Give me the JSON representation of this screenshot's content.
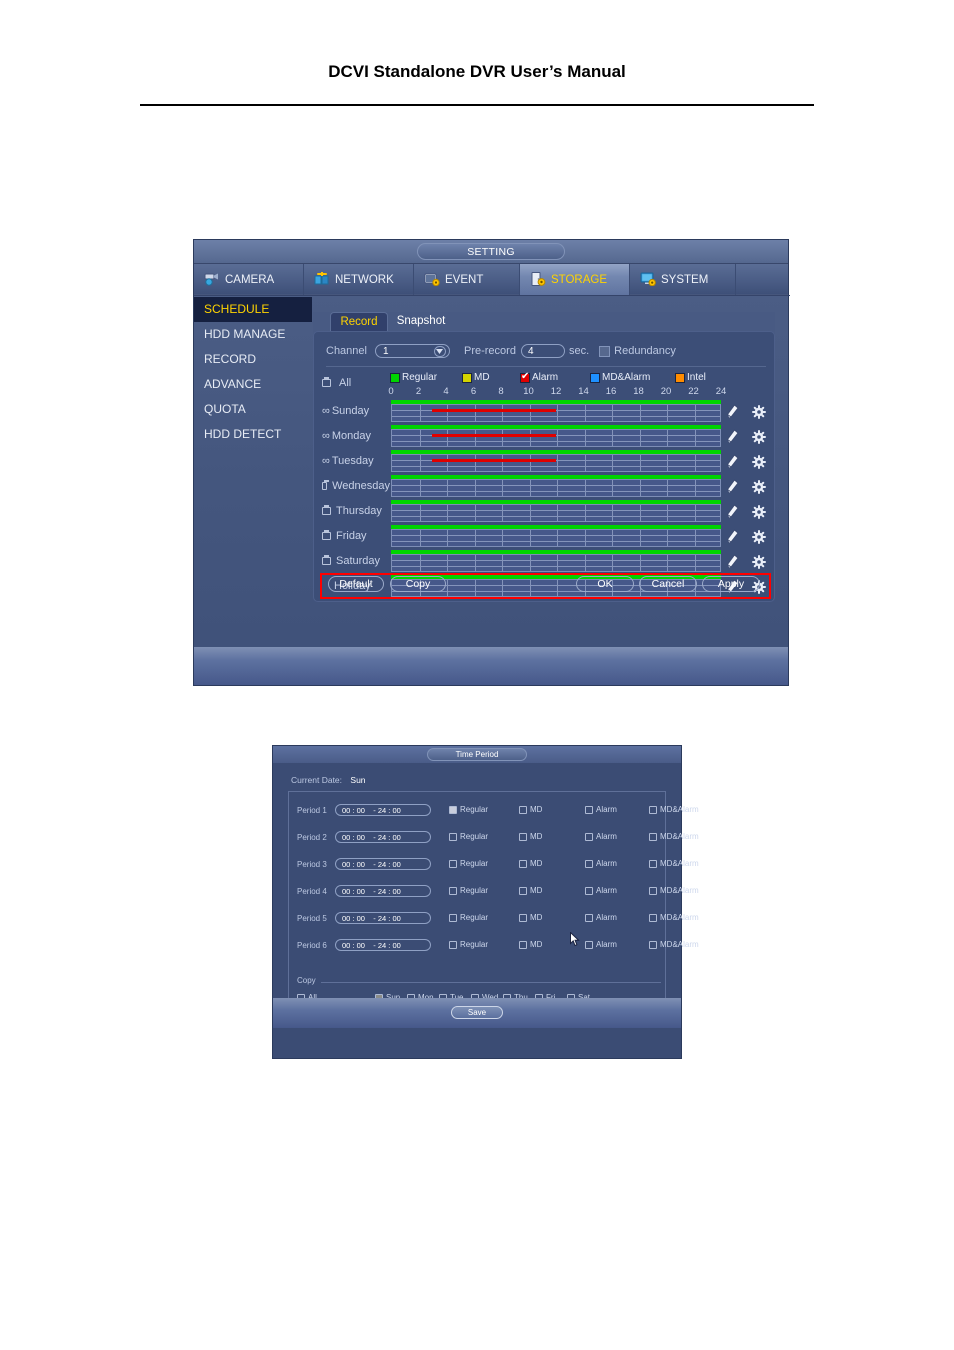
{
  "page": {
    "header_title": "DCVI Standalone DVR User’s Manual"
  },
  "setting_window": {
    "title": "SETTING",
    "top_tabs": [
      {
        "label": "CAMERA",
        "icon": "camera-icon",
        "active": false
      },
      {
        "label": "NETWORK",
        "icon": "network-icon",
        "active": false
      },
      {
        "label": "EVENT",
        "icon": "event-icon",
        "active": false
      },
      {
        "label": "STORAGE",
        "icon": "storage-icon",
        "active": true
      },
      {
        "label": "SYSTEM",
        "icon": "system-icon",
        "active": false
      }
    ],
    "side_menu": [
      {
        "label": "SCHEDULE",
        "active": true
      },
      {
        "label": "HDD MANAGE",
        "active": false
      },
      {
        "label": "RECORD",
        "active": false
      },
      {
        "label": "ADVANCE",
        "active": false
      },
      {
        "label": "QUOTA",
        "active": false
      },
      {
        "label": "HDD DETECT",
        "active": false
      }
    ],
    "inner_tabs": [
      {
        "label": "Record",
        "active": true
      },
      {
        "label": "Snapshot",
        "active": false
      }
    ],
    "channel_label": "Channel",
    "channel_value": "1",
    "prerecord_label": "Pre-record",
    "prerecord_value": "4",
    "sec_label": "sec.",
    "redundancy_label": "Redundancy",
    "legend": [
      {
        "label": "Regular",
        "color": "#00d400",
        "checked": false
      },
      {
        "label": "MD",
        "color": "#d4d400",
        "checked": false
      },
      {
        "label": "Alarm",
        "color": "#e00000",
        "checked": true
      },
      {
        "label": "MD&Alarm",
        "color": "#1e90ff",
        "checked": false
      },
      {
        "label": "Intel",
        "color": "#ff8c00",
        "checked": false
      }
    ],
    "ruler_ticks": [
      "0",
      "2",
      "4",
      "6",
      "8",
      "10",
      "12",
      "14",
      "16",
      "18",
      "20",
      "22",
      "24"
    ],
    "all_label": "All",
    "day_rows": [
      {
        "label": "Sunday",
        "linked": true,
        "regular": [
          0,
          24
        ],
        "alarm": [
          3,
          12
        ]
      },
      {
        "label": "Monday",
        "linked": true,
        "regular": [
          0,
          24
        ],
        "alarm": [
          3,
          12
        ]
      },
      {
        "label": "Tuesday",
        "linked": true,
        "regular": [
          0,
          24
        ],
        "alarm": [
          3,
          12
        ]
      },
      {
        "label": "Wednesday",
        "linked": false,
        "regular": [
          0,
          24
        ],
        "alarm": null
      },
      {
        "label": "Thursday",
        "linked": false,
        "regular": [
          0,
          24
        ],
        "alarm": null
      },
      {
        "label": "Friday",
        "linked": false,
        "regular": [
          0,
          24
        ],
        "alarm": null
      },
      {
        "label": "Saturday",
        "linked": false,
        "regular": [
          0,
          24
        ],
        "alarm": null
      },
      {
        "label": "Holiday",
        "linked": false,
        "regular": [
          0,
          24
        ],
        "alarm": null,
        "highlighted": true
      }
    ],
    "buttons": {
      "default": "Default",
      "copy": "Copy",
      "ok": "OK",
      "cancel": "Cancel",
      "apply": "Apply"
    }
  },
  "time_period_window": {
    "title": "Time Period",
    "current_date_label": "Current Date:",
    "current_date_value": "Sun",
    "period_mode_labels": [
      "Regular",
      "MD",
      "Alarm",
      "MD&Alarm"
    ],
    "periods": [
      {
        "label": "Period 1",
        "start": "00 : 00",
        "end": "24 : 00",
        "regular": true,
        "md": false,
        "alarm": false,
        "md_alarm": false
      },
      {
        "label": "Period 2",
        "start": "00 : 00",
        "end": "24 : 00",
        "regular": false,
        "md": false,
        "alarm": false,
        "md_alarm": false
      },
      {
        "label": "Period 3",
        "start": "00 : 00",
        "end": "24 : 00",
        "regular": false,
        "md": false,
        "alarm": false,
        "md_alarm": false
      },
      {
        "label": "Period 4",
        "start": "00 : 00",
        "end": "24 : 00",
        "regular": false,
        "md": false,
        "alarm": false,
        "md_alarm": false
      },
      {
        "label": "Period 5",
        "start": "00 : 00",
        "end": "24 : 00",
        "regular": false,
        "md": false,
        "alarm": false,
        "md_alarm": false
      },
      {
        "label": "Period 6",
        "start": "00 : 00",
        "end": "24 : 00",
        "regular": false,
        "md": false,
        "alarm": false,
        "md_alarm": false
      }
    ],
    "copy_label": "Copy",
    "copy_all_label": "All",
    "copy_days": [
      {
        "label": "Sun",
        "checked": true
      },
      {
        "label": "Mon",
        "checked": false
      },
      {
        "label": "Tue",
        "checked": false
      },
      {
        "label": "Wed",
        "checked": false
      },
      {
        "label": "Thu",
        "checked": false
      },
      {
        "label": "Fri",
        "checked": false
      },
      {
        "label": "Sat",
        "checked": false
      }
    ],
    "save_label": "Save"
  }
}
